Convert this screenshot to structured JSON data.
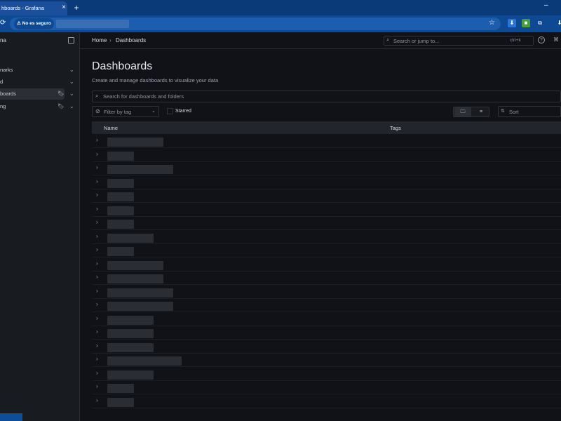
{
  "browser": {
    "tab_title": "hboards - Grafana",
    "tab_close": "×",
    "new_tab": "+",
    "minimize": "–",
    "reload_icon": "⟳",
    "security_label": "⚠ No es seguro",
    "star_icon": "☆",
    "extensions": [
      {
        "icon": "download-icon",
        "glyph": "⬇"
      },
      {
        "icon": "green-extension-icon",
        "glyph": "■"
      },
      {
        "icon": "puzzle-icon",
        "glyph": "⧉"
      },
      {
        "icon": "downloads-icon",
        "glyph": "⬇"
      }
    ]
  },
  "sidebar": {
    "brand": "na",
    "dock_icon": "dock-icon",
    "items": [
      {
        "label": "narks",
        "chevron": "⌄",
        "bookmark": ""
      },
      {
        "label": "d",
        "chevron": "⌄",
        "bookmark": ""
      },
      {
        "label": "boards",
        "chevron": "⌄",
        "bookmark": "🔖︎",
        "active": true
      },
      {
        "label": "ng",
        "chevron": "⌄",
        "bookmark": "🔖︎"
      }
    ]
  },
  "topnav": {
    "breadcrumb": [
      {
        "label": "Home"
      },
      {
        "label": "Dashboards"
      }
    ],
    "breadcrumb_sep": "›",
    "search_placeholder": "Search or jump to...",
    "search_icon": "⌕",
    "shortcut": "ctrl+k",
    "help_icon": "?",
    "rss_icon": "⌘"
  },
  "page": {
    "title": "Dashboards",
    "subtitle": "Create and manage dashboards to visualize your data",
    "search_placeholder": "Search for dashboards and folders",
    "search_icon": "⌕",
    "filter_tag_label": "Filter by tag",
    "filter_tag_icon": "⊘",
    "filter_tag_chevron": "⌄",
    "starred_label": "Starred",
    "view_folder_icon": "🗀︎",
    "view_list_icon": "≡",
    "sort_label": "Sort",
    "sort_icon": "⇅"
  },
  "table": {
    "columns": [
      "Name",
      "Tags"
    ],
    "row_count": 20,
    "expand_icon": "›"
  }
}
